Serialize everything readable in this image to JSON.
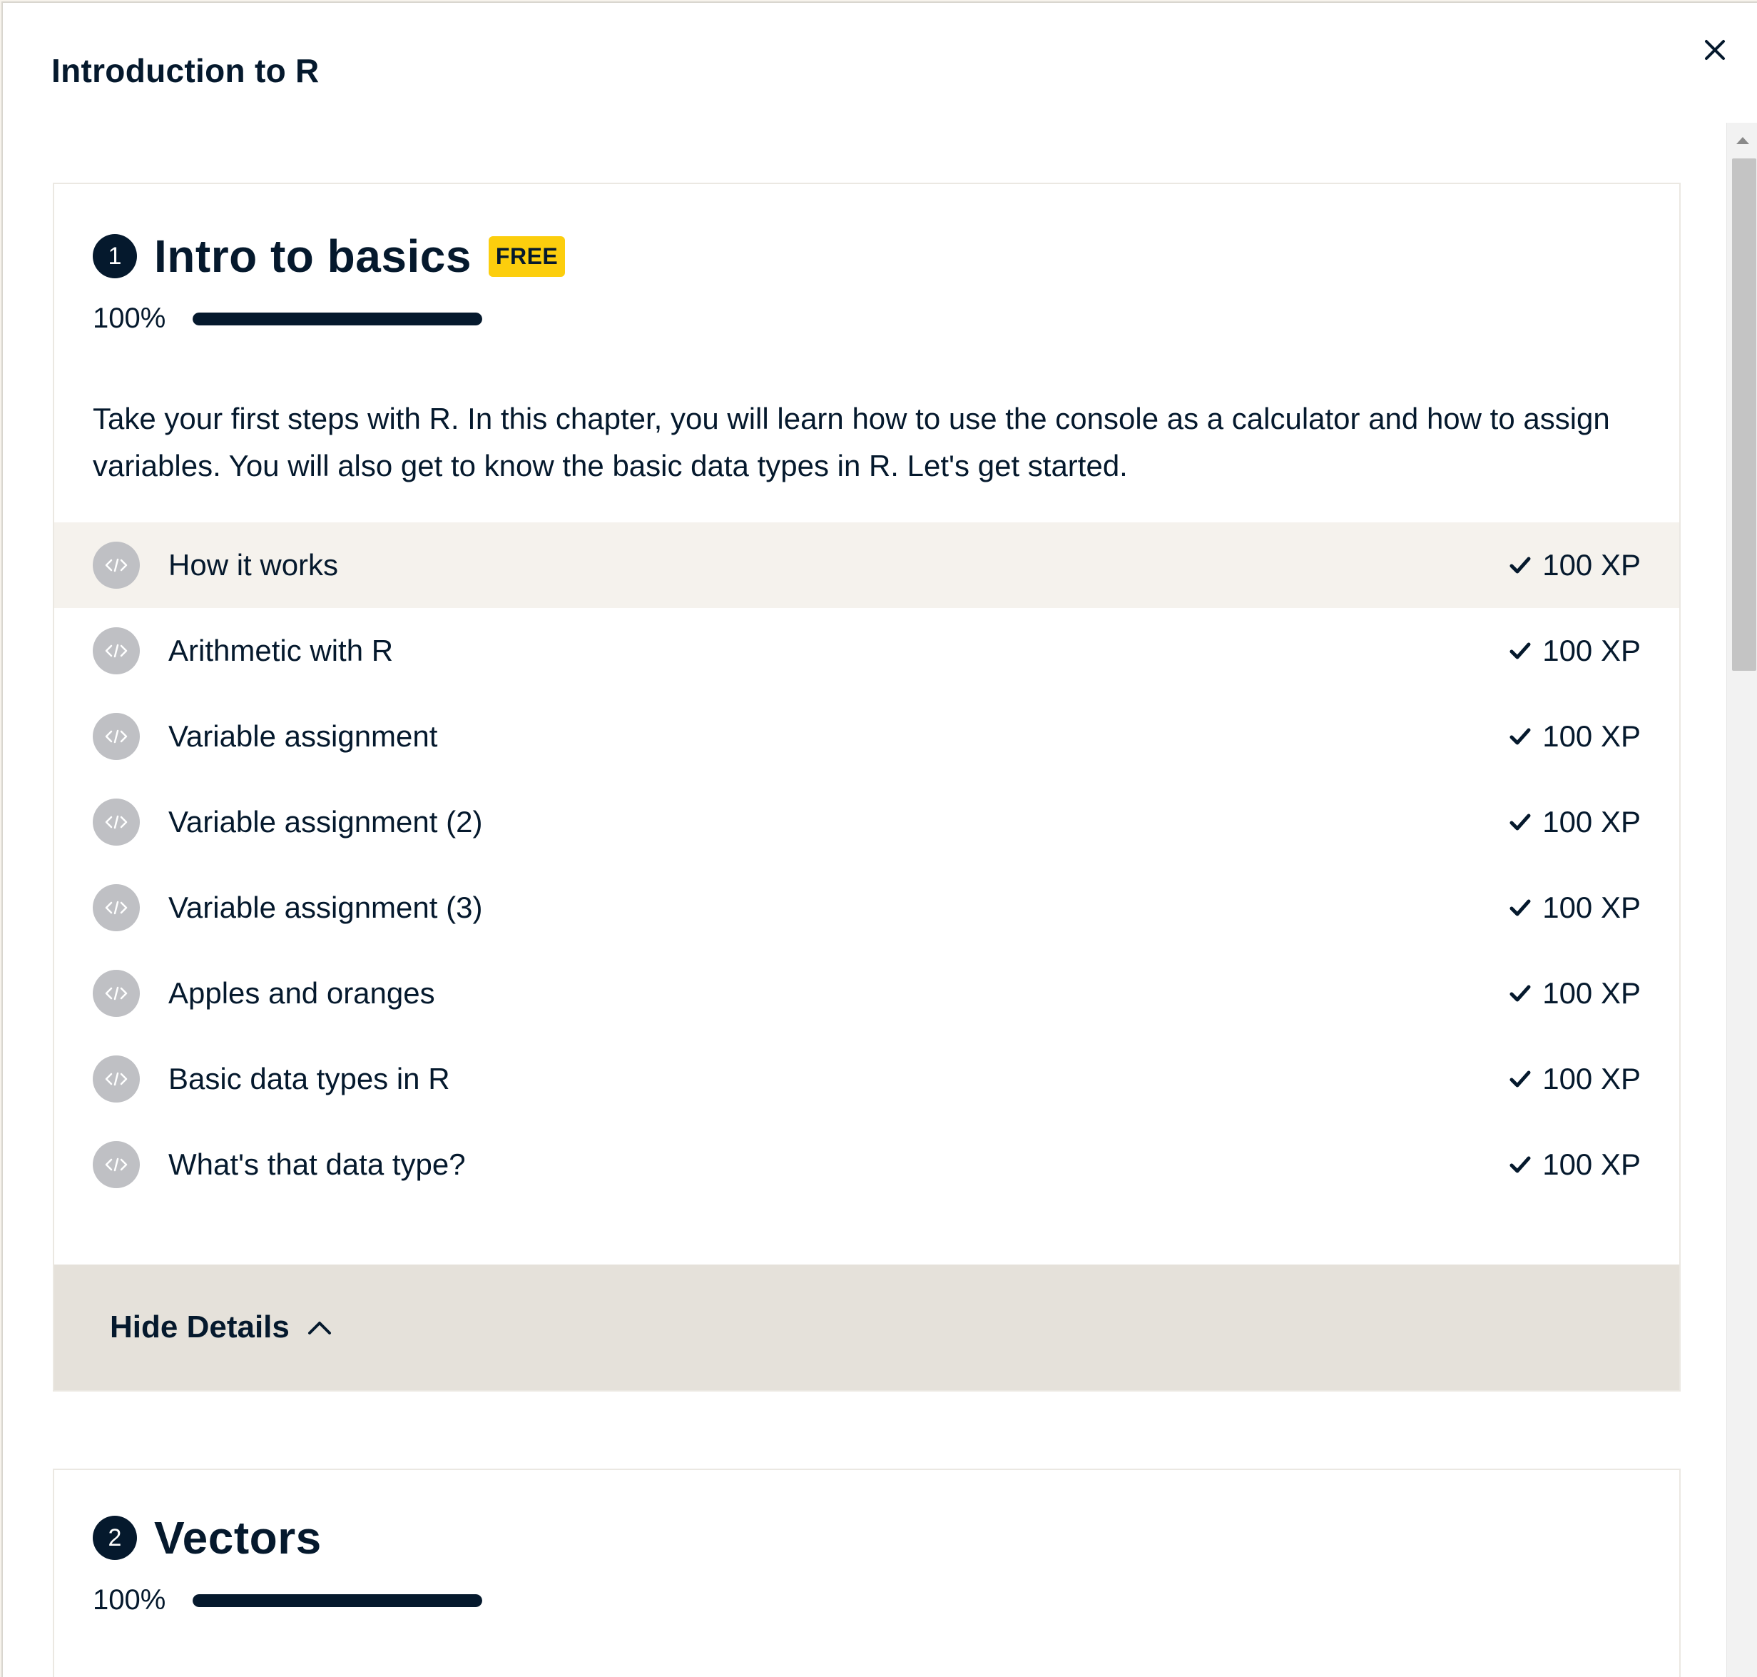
{
  "modal": {
    "title": "Introduction to R"
  },
  "chapters": [
    {
      "number": "1",
      "title": "Intro to basics",
      "badge": "FREE",
      "progress_label": "100%",
      "progress": 1.0,
      "description": "Take your first steps with R. In this chapter, you will learn how to use the console as a calculator and how to assign variables. You will also get to know the basic data types in R. Let's get started.",
      "exercises": [
        {
          "name": "How it works",
          "xp": "100 XP"
        },
        {
          "name": "Arithmetic with R",
          "xp": "100 XP"
        },
        {
          "name": "Variable assignment",
          "xp": "100 XP"
        },
        {
          "name": "Variable assignment (2)",
          "xp": "100 XP"
        },
        {
          "name": "Variable assignment (3)",
          "xp": "100 XP"
        },
        {
          "name": "Apples and oranges",
          "xp": "100 XP"
        },
        {
          "name": "Basic data types in R",
          "xp": "100 XP"
        },
        {
          "name": "What's that data type?",
          "xp": "100 XP"
        }
      ],
      "toggle_label": "Hide Details"
    },
    {
      "number": "2",
      "title": "Vectors",
      "progress_label": "100%",
      "progress": 1.0
    }
  ],
  "icons": {
    "close": "close-icon",
    "exercise": "code-icon",
    "completed": "checkmark-icon",
    "toggle": "chevron-up-icon"
  },
  "colors": {
    "ink": "#05192d",
    "badge": "#fcce0d",
    "row_highlight": "#f5f2ed",
    "details_bar": "#e5e1da",
    "exercise_icon": "#bfc0c4"
  }
}
